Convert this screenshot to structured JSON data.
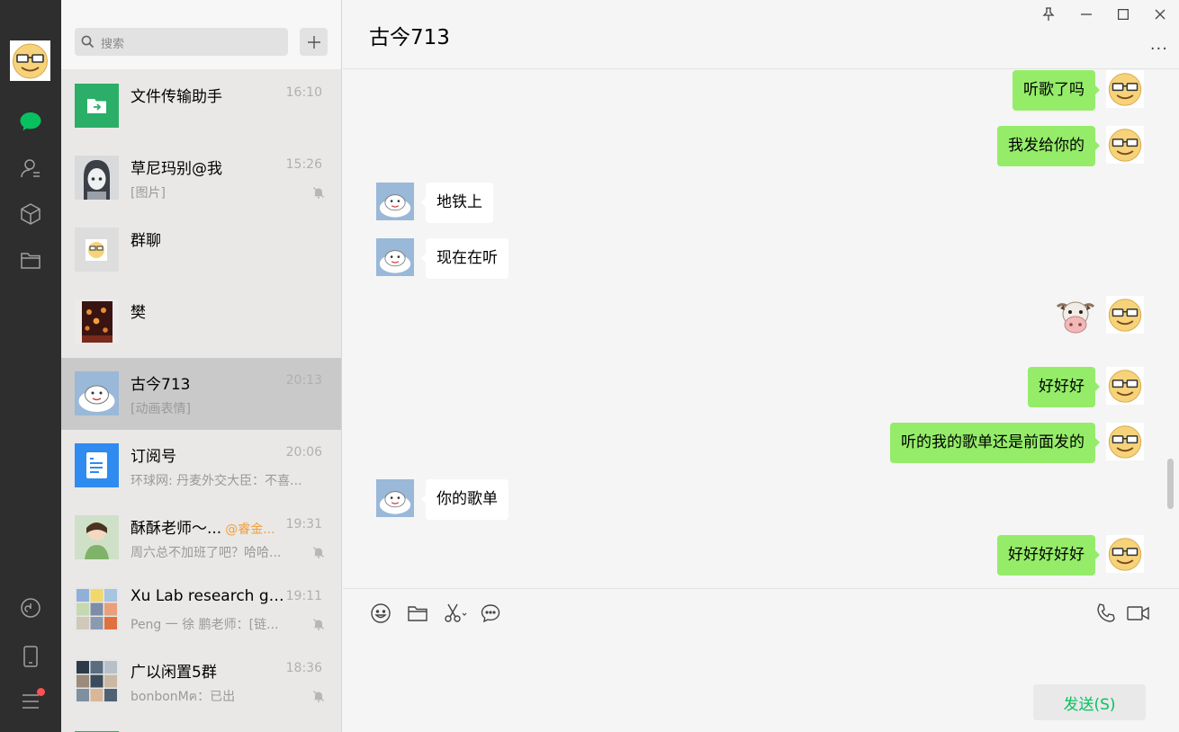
{
  "sidebar": {
    "icons": [
      "chat-icon",
      "contacts-icon",
      "favorites-icon",
      "files-icon",
      "moments-icon",
      "phone-icon",
      "menu-icon"
    ],
    "accent": "#07c160"
  },
  "search": {
    "placeholder": "搜索",
    "add_label": "+"
  },
  "conversations": [
    {
      "name": "文件传输助手",
      "time": "16:10",
      "preview": "",
      "muted": false
    },
    {
      "name": "草尼玛别@我",
      "time": "15:26",
      "preview": "[图片]",
      "muted": true
    },
    {
      "name": "群聊",
      "time": "",
      "preview": "",
      "muted": false
    },
    {
      "name": "樊",
      "time": "",
      "preview": "",
      "muted": false
    },
    {
      "name": "古今713",
      "time": "20:13",
      "preview": "[动画表情]",
      "muted": false,
      "selected": true
    },
    {
      "name": "订阅号",
      "time": "20:06",
      "preview": "环球网: 丹麦外交大臣：不喜...",
      "muted": false
    },
    {
      "name": "酥酥老师～...",
      "mention": "@睿金...",
      "time": "19:31",
      "preview": "周六总不加班了吧？哈哈...",
      "muted": true
    },
    {
      "name": "Xu Lab research gr...",
      "time": "19:11",
      "preview": "Peng 一 徐 鹏老师：[链...",
      "muted": true
    },
    {
      "name": "广以闲置5群",
      "time": "18:36",
      "preview": "bonbonMฅ：已出",
      "muted": true
    }
  ],
  "chat": {
    "title": "古今713",
    "messages": [
      {
        "dir": "out",
        "text": "听歌了吗"
      },
      {
        "dir": "out",
        "text": "我发给你的"
      },
      {
        "dir": "in",
        "text": "地铁上"
      },
      {
        "dir": "in",
        "text": "现在在听"
      },
      {
        "dir": "out",
        "emoji": "cow-emoji"
      },
      {
        "dir": "out",
        "text": "好好好"
      },
      {
        "dir": "out",
        "text": "听的我的歌单还是前面发的"
      },
      {
        "dir": "in",
        "text": "你的歌单"
      },
      {
        "dir": "out",
        "text": "好好好好好"
      }
    ],
    "more_label": "···"
  },
  "composer": {
    "tools": [
      "emoji-icon",
      "folder-icon",
      "scissors-icon",
      "chat-history-icon",
      "voice-call-icon",
      "video-call-icon"
    ],
    "send_label": "发送(S)"
  }
}
